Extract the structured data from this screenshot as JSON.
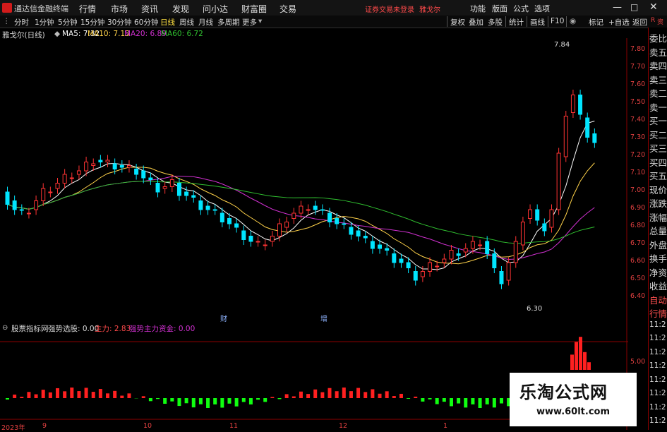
{
  "app": {
    "name": "通达信金融终端",
    "notice": "证券交易未登录",
    "stock_tab": "雅戈尔"
  },
  "menu": [
    "行情",
    "市场",
    "资讯",
    "发现",
    "问小达",
    "财富圈",
    "交易"
  ],
  "right_menu": [
    "功能",
    "版面",
    "公式",
    "选项"
  ],
  "toolbar": {
    "periods": [
      "分时",
      "1分钟",
      "5分钟",
      "15分钟",
      "30分钟",
      "60分钟",
      "日线",
      "周线",
      "月线",
      "多周期",
      "更多"
    ],
    "right": [
      "复权",
      "叠加",
      "多股",
      "统计",
      "画线",
      "F10",
      "标记",
      "+自选",
      "返回"
    ]
  },
  "chart_header": {
    "stock": "雅戈尔(日线)",
    "ma5": "MA5: 7.32",
    "ma10": "MA10: 7.13",
    "ma20": "MA20: 6.89",
    "ma60": "MA60: 6.72"
  },
  "price_labels": [
    "7.80",
    "7.70",
    "7.60",
    "7.50",
    "7.40",
    "7.30",
    "7.20",
    "7.10",
    "7.00",
    "6.90",
    "6.80",
    "6.70",
    "6.60",
    "6.50",
    "6.40"
  ],
  "annotations": {
    "high": "7.84",
    "low": "6.30",
    "mark_a": "财",
    "mark_b": "增"
  },
  "indicator": {
    "name": "股票指标网",
    "sub": "强势选股: 0.00",
    "main": "主力: 2.83",
    "strong": "强势主力资金: 0.00",
    "scale": "5.00"
  },
  "right_panel": [
    "委比",
    "卖五",
    "卖四",
    "卖三",
    "卖二",
    "卖一",
    "买一",
    "买二",
    "买三",
    "买四",
    "买五",
    "现价",
    "涨跌",
    "涨幅",
    "总量",
    "外盘",
    "换手",
    "净资",
    "收益",
    "自动",
    "行情",
    "11:2",
    "11:2",
    "11:2",
    "11:2",
    "11:2",
    "11:2",
    "11:2",
    "11:2"
  ],
  "right_panel_top": [
    "资",
    "R"
  ],
  "date_axis": [
    "2023年",
    "9",
    "10",
    "11",
    "12",
    "1"
  ],
  "watermark": {
    "line1": "乐淘公式网",
    "line2": "www.60lt.com"
  },
  "colors": {
    "up": "#ff3333",
    "down": "#00e5ff",
    "ma5": "#ffffff",
    "ma10": "#ffd24a",
    "ma20": "#d030d0",
    "ma60": "#30c030",
    "bar_up": "#ff2020",
    "bar_down": "#10ff10"
  }
}
